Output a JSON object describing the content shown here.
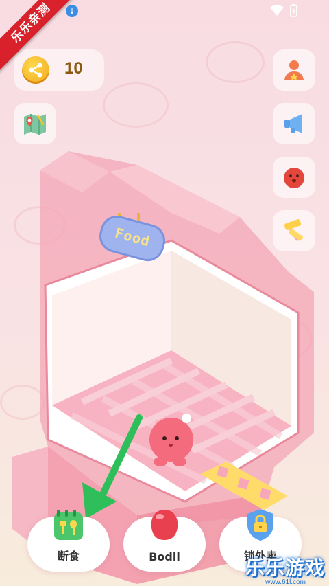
{
  "promo_ribbon": "乐乐亲测",
  "coins": {
    "count": "10",
    "icon": "share-coin-icon"
  },
  "right_buttons": [
    {
      "name": "profile",
      "icon": "person-star-icon"
    },
    {
      "name": "announce",
      "icon": "megaphone-icon"
    },
    {
      "name": "pet",
      "icon": "red-blob-icon"
    },
    {
      "name": "tools",
      "icon": "yellow-roller-icon"
    }
  ],
  "left_buttons": [
    {
      "name": "map",
      "icon": "map-pin-icon"
    }
  ],
  "sign_text": "Food",
  "bottom_nav": [
    {
      "label": "断食",
      "icon": "calendar-fork-spoon-icon"
    },
    {
      "label": "Bodii",
      "icon": "red-blob-icon"
    },
    {
      "label": "锁外卖",
      "icon": "shield-lock-icon"
    }
  ],
  "watermark": {
    "text": "乐乐游戏",
    "url": "www.61l.com"
  },
  "colors": {
    "accent_pink": "#f49aa9",
    "coin": "#f5b82a",
    "arrow_green": "#2fbf5a"
  }
}
